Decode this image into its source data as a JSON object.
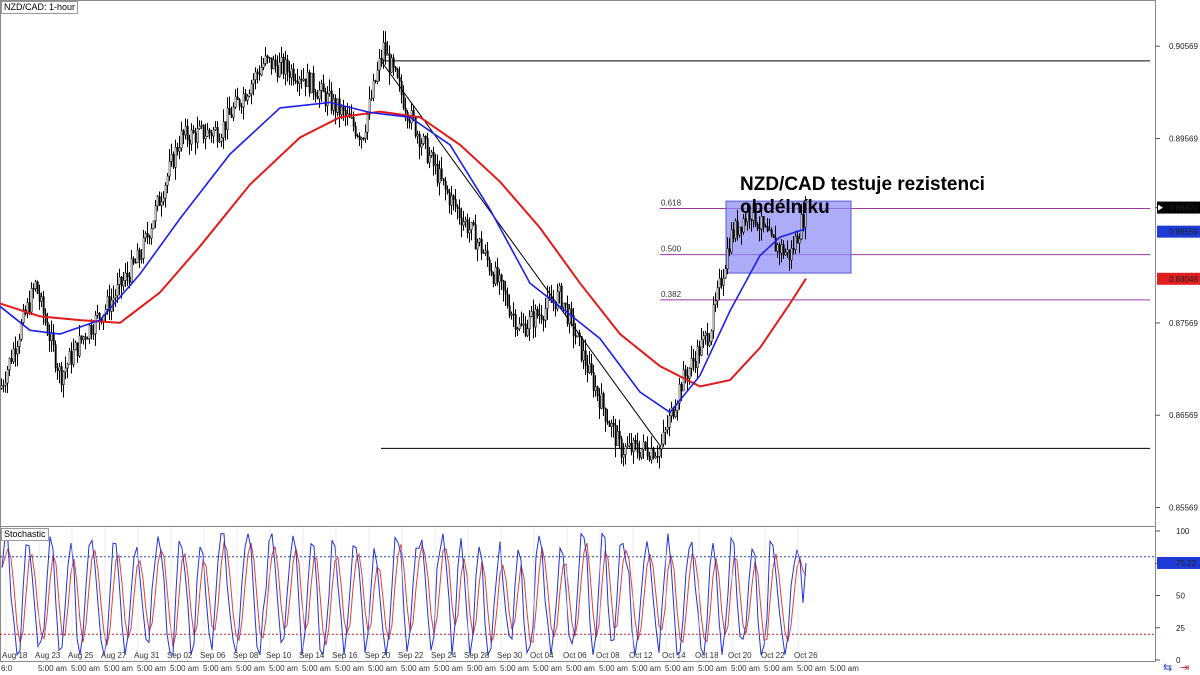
{
  "chart_title": "NZD/CAD: 1-hour",
  "annotation_text": [
    "NZD/CAD testuje rezistenci",
    "obdélníku"
  ],
  "colors": {
    "candle": "#000000",
    "ma_fast": "#1e1ef0",
    "ma_slow": "#e31a1a",
    "rect_fill": "#8c8cf5",
    "fib_line": "#9b3aa0",
    "stoch_k": "#2233d6",
    "stoch_d": "#d8433a",
    "level_high": "#2244aa",
    "level_low": "#cc2222",
    "badge_price": "#000000",
    "badge_blue": "#1e3bd6",
    "badge_red": "#e02020"
  },
  "chart_data": {
    "type": "line",
    "title": "NZD/CAD: 1-hour",
    "ylim": [
      0.8539,
      0.9107
    ],
    "y_ticks": [
      "0.90569",
      "0.89569",
      "0.88820",
      "0.87569",
      "0.86569",
      "0.85569"
    ],
    "x_tick_dates": [
      "Aug 18",
      "Aug 23",
      "Aug 25",
      "Aug 27",
      "Aug 31",
      "Sep 02",
      "Sep 06",
      "Sep 08",
      "Sep 10",
      "Sep 14",
      "Sep 16",
      "Sep 20",
      "Sep 22",
      "Sep 24",
      "Sep 28",
      "Sep 30",
      "Oct 04",
      "Oct 06",
      "Oct 08",
      "Oct 12",
      "Oct 14",
      "Oct 18",
      "Oct 20",
      "Oct 22",
      "Oct 26"
    ],
    "x_tick_times": [
      "6:0",
      "5:00 am",
      "5:00 am",
      "5:00 am",
      "5:00 am",
      "5:00 am",
      "5:00 am",
      "5:00 am",
      "5:00 am",
      "5:00 am",
      "5:00 am",
      "5:00 am",
      "5:00 am",
      "5:00 am",
      "5:00 am",
      "5:00 am",
      "5:00 am",
      "5:00 am",
      "5:00 am",
      "5:00 am",
      "5:00 am",
      "5:00 am",
      "5:00 am",
      "5:00 am",
      "5:00 am",
      "5:00 am"
    ],
    "price_path": [
      [
        0,
        0.8686
      ],
      [
        35,
        0.8798
      ],
      [
        60,
        0.87
      ],
      [
        85,
        0.8746
      ],
      [
        110,
        0.878
      ],
      [
        140,
        0.883
      ],
      [
        180,
        0.8958
      ],
      [
        220,
        0.8966
      ],
      [
        264,
        0.904
      ],
      [
        300,
        0.9027
      ],
      [
        340,
        0.8986
      ],
      [
        362,
        0.896
      ],
      [
        383,
        0.9055
      ],
      [
        410,
        0.898
      ],
      [
        445,
        0.89
      ],
      [
        480,
        0.884
      ],
      [
        520,
        0.875
      ],
      [
        560,
        0.8787
      ],
      [
        590,
        0.87
      ],
      [
        620,
        0.862
      ],
      [
        660,
        0.862
      ],
      [
        680,
        0.869
      ],
      [
        710,
        0.875
      ],
      [
        730,
        0.885
      ],
      [
        750,
        0.888
      ],
      [
        770,
        0.8845
      ],
      [
        790,
        0.883
      ],
      [
        806,
        0.8882
      ]
    ],
    "ma_fast_path": [
      [
        0,
        0.8775
      ],
      [
        30,
        0.8749
      ],
      [
        60,
        0.8745
      ],
      [
        100,
        0.876
      ],
      [
        140,
        0.881
      ],
      [
        180,
        0.887
      ],
      [
        230,
        0.894
      ],
      [
        280,
        0.899
      ],
      [
        330,
        0.8996
      ],
      [
        370,
        0.8985
      ],
      [
        410,
        0.898
      ],
      [
        450,
        0.895
      ],
      [
        490,
        0.888
      ],
      [
        530,
        0.88
      ],
      [
        570,
        0.8766
      ],
      [
        600,
        0.874
      ],
      [
        640,
        0.8682
      ],
      [
        670,
        0.866
      ],
      [
        700,
        0.87
      ],
      [
        730,
        0.877
      ],
      [
        760,
        0.883
      ],
      [
        780,
        0.885
      ],
      [
        806,
        0.8859
      ]
    ],
    "ma_slow_path": [
      [
        0,
        0.8778
      ],
      [
        40,
        0.8764
      ],
      [
        80,
        0.876
      ],
      [
        120,
        0.8757
      ],
      [
        160,
        0.879
      ],
      [
        200,
        0.884
      ],
      [
        250,
        0.8907
      ],
      [
        300,
        0.8958
      ],
      [
        340,
        0.898
      ],
      [
        380,
        0.8986
      ],
      [
        420,
        0.898
      ],
      [
        460,
        0.895
      ],
      [
        500,
        0.891
      ],
      [
        540,
        0.886
      ],
      [
        580,
        0.88
      ],
      [
        620,
        0.8745
      ],
      [
        660,
        0.871
      ],
      [
        700,
        0.8688
      ],
      [
        730,
        0.8695
      ],
      [
        760,
        0.873
      ],
      [
        790,
        0.8778
      ],
      [
        806,
        0.8805
      ]
    ],
    "current_price": "0.88820",
    "ma_fast_value": "0.88559",
    "ma_slow_value": "0.88048",
    "swing_high": 0.9041,
    "swing_low": 0.8621,
    "fib_levels": [
      {
        "label": "0.618",
        "value": 0.8881
      },
      {
        "label": "0.500",
        "value": 0.8831
      },
      {
        "label": "0.382",
        "value": 0.8782
      }
    ],
    "rectangle": {
      "x_start": 726,
      "x_end": 851,
      "top": 0.8889,
      "bottom": 0.8811
    },
    "stochastic": {
      "title": "Stochastic",
      "ylim": [
        0,
        100
      ],
      "y_ticks": [
        "100",
        "75",
        "50",
        "25",
        "0"
      ],
      "overbought": 80,
      "oversold": 20,
      "current_value": "75.22"
    }
  }
}
